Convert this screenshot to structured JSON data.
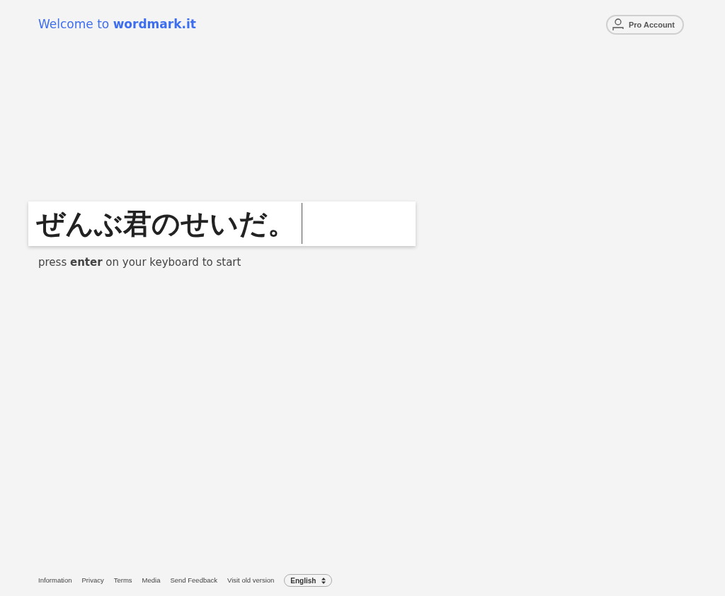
{
  "header": {
    "welcome": "Welcome to **wordmark.it**",
    "account_button": "Pro Account"
  },
  "input": {
    "value": "ぜんぶ君のせいだ。"
  },
  "hint": "press **enter** on your keyboard to start",
  "footer": {
    "links": [
      "Information",
      "Privacy",
      "Terms",
      "Media",
      "Send Feedback",
      "Visit old version"
    ],
    "language": "English"
  }
}
